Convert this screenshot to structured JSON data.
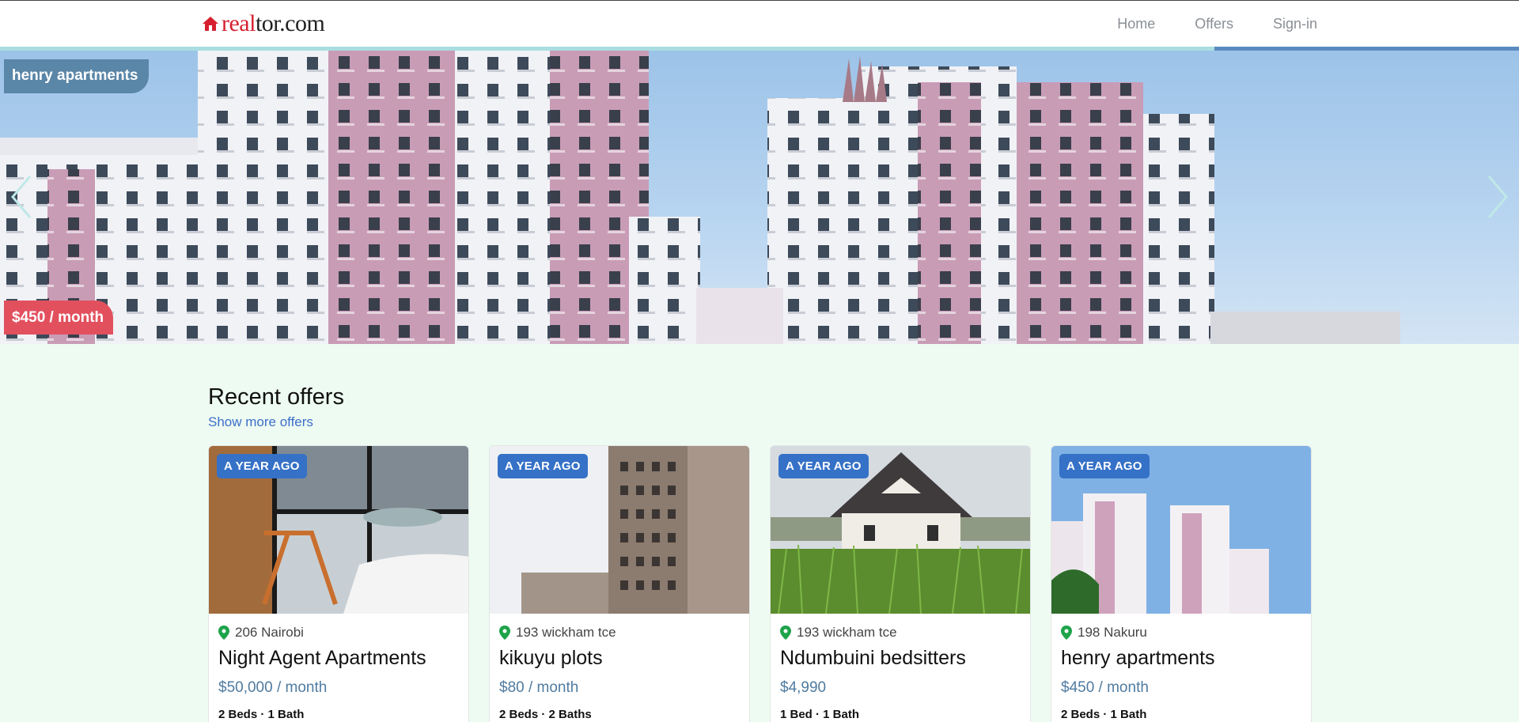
{
  "navbar": {
    "brand_real": "real",
    "brand_tor": "tor.com",
    "links": [
      "Home",
      "Offers",
      "Sign-in"
    ]
  },
  "hero": {
    "title": "henry apartments",
    "price": "$450 / month"
  },
  "section": {
    "heading": "Recent offers",
    "more_link": "Show more offers"
  },
  "cards": [
    {
      "badge": "A YEAR AGO",
      "location": "206 Nairobi",
      "title": "Night Agent Apartments",
      "price": "$50,000 / month",
      "specs": "2 Beds · 1 Bath"
    },
    {
      "badge": "A YEAR AGO",
      "location": "193 wickham tce",
      "title": "kikuyu plots",
      "price": "$80 / month",
      "specs": "2 Beds · 2 Baths"
    },
    {
      "badge": "A YEAR AGO",
      "location": "193 wickham tce",
      "title": "Ndumbuini bedsitters",
      "price": "$4,990",
      "specs": "1 Bed · 1 Bath"
    },
    {
      "badge": "A YEAR AGO",
      "location": "198 Nakuru",
      "title": "henry apartments",
      "price": "$450 / month",
      "specs": "2 Beds · 1 Bath"
    }
  ],
  "colors": {
    "brand_red": "#d6202f",
    "badge_blue": "#3571c6",
    "price_blue": "#4f7ba0",
    "hero_title_bg": "#5a86a7",
    "hero_price_bg": "#e2505e",
    "page_bg": "#eefbf2",
    "location_pin": "#1ea34a"
  },
  "icons": [
    "house-logo-icon",
    "chevron-left-icon",
    "chevron-right-icon",
    "location-pin-icon"
  ]
}
